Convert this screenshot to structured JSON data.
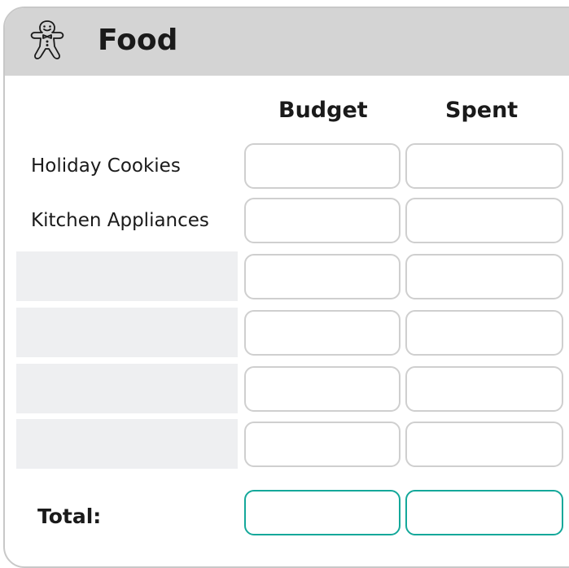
{
  "header": {
    "title": "Food",
    "icon": "gingerbread-man-icon"
  },
  "columns": {
    "budget": "Budget",
    "spent": "Spent"
  },
  "rows": [
    {
      "label": "Holiday Cookies",
      "budget": "",
      "spent": ""
    },
    {
      "label": "Kitchen Appliances",
      "budget": "",
      "spent": ""
    },
    {
      "label": "",
      "budget": "",
      "spent": ""
    },
    {
      "label": "",
      "budget": "",
      "spent": ""
    },
    {
      "label": "",
      "budget": "",
      "spent": ""
    },
    {
      "label": "",
      "budget": "",
      "spent": ""
    }
  ],
  "total": {
    "label": "Total:",
    "budget": "",
    "spent": ""
  },
  "colors": {
    "header_bg": "#d4d4d4",
    "field_border": "#cfcfcf",
    "total_border": "#14a89a",
    "empty_label_bg": "#eeeff1"
  }
}
